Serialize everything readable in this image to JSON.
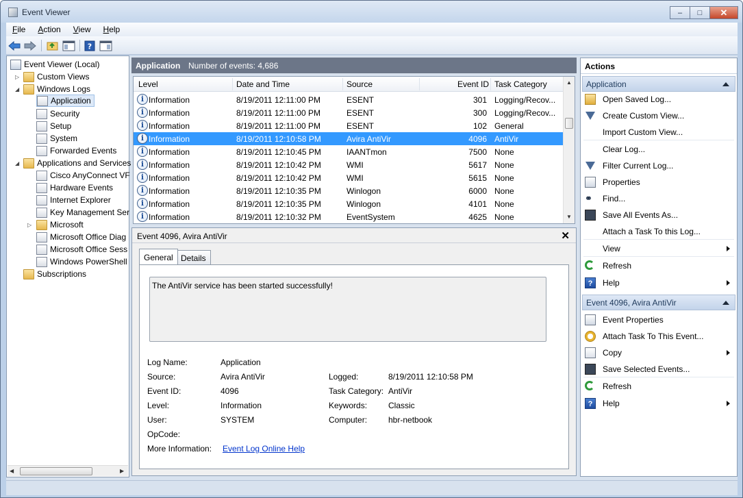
{
  "window": {
    "title": "Event Viewer",
    "min": "–",
    "max": "□",
    "close": "✕"
  },
  "menu": [
    "File",
    "Action",
    "View",
    "Help"
  ],
  "toolbar": {
    "icons": [
      "back-arrow-icon",
      "forward-arrow-icon",
      "up-folder-icon",
      "show-hide-tree-icon",
      "help-icon",
      "show-hide-action-pane-icon"
    ]
  },
  "tree": {
    "root": "Event Viewer (Local)",
    "custom_views": "Custom Views",
    "windows_logs": "Windows Logs",
    "windows_logs_items": [
      "Application",
      "Security",
      "Setup",
      "System",
      "Forwarded Events"
    ],
    "apps_services": "Applications and Services",
    "apps_services_items": [
      "Cisco AnyConnect VF",
      "Hardware Events",
      "Internet Explorer",
      "Key Management Ser",
      "Microsoft",
      "Microsoft Office Diag",
      "Microsoft Office Sess",
      "Windows PowerShell"
    ],
    "subscriptions": "Subscriptions"
  },
  "center": {
    "log_name": "Application",
    "event_count": "Number of events: 4,686",
    "columns": [
      "Level",
      "Date and Time",
      "Source",
      "Event ID",
      "Task Category"
    ],
    "rows": [
      {
        "level": "Information",
        "date": "8/19/2011 12:11:00 PM",
        "source": "ESENT",
        "id": "301",
        "category": "Logging/Recov..."
      },
      {
        "level": "Information",
        "date": "8/19/2011 12:11:00 PM",
        "source": "ESENT",
        "id": "300",
        "category": "Logging/Recov..."
      },
      {
        "level": "Information",
        "date": "8/19/2011 12:11:00 PM",
        "source": "ESENT",
        "id": "102",
        "category": "General"
      },
      {
        "level": "Information",
        "date": "8/19/2011 12:10:58 PM",
        "source": "Avira AntiVir",
        "id": "4096",
        "category": "AntiVir"
      },
      {
        "level": "Information",
        "date": "8/19/2011 12:10:45 PM",
        "source": "IAANTmon",
        "id": "7500",
        "category": "None"
      },
      {
        "level": "Information",
        "date": "8/19/2011 12:10:42 PM",
        "source": "WMI",
        "id": "5617",
        "category": "None"
      },
      {
        "level": "Information",
        "date": "8/19/2011 12:10:42 PM",
        "source": "WMI",
        "id": "5615",
        "category": "None"
      },
      {
        "level": "Information",
        "date": "8/19/2011 12:10:35 PM",
        "source": "Winlogon",
        "id": "6000",
        "category": "None"
      },
      {
        "level": "Information",
        "date": "8/19/2011 12:10:35 PM",
        "source": "Winlogon",
        "id": "4101",
        "category": "None"
      },
      {
        "level": "Information",
        "date": "8/19/2011 12:10:32 PM",
        "source": "EventSystem",
        "id": "4625",
        "category": "None"
      }
    ],
    "selected_row": 3
  },
  "detail": {
    "title": "Event 4096, Avira AntiVir",
    "close": "✕",
    "tabs": [
      "General",
      "Details"
    ],
    "description": "The AntiVir service has been started successfully!",
    "labels": {
      "log_name": "Log Name:",
      "source": "Source:",
      "event_id": "Event ID:",
      "level": "Level:",
      "user": "User:",
      "opcode": "OpCode:",
      "more_info": "More Information:",
      "logged": "Logged:",
      "task_category": "Task Category:",
      "keywords": "Keywords:",
      "computer": "Computer:"
    },
    "values": {
      "log_name": "Application",
      "source": "Avira AntiVir",
      "event_id": "4096",
      "level": "Information",
      "user": "SYSTEM",
      "opcode": "",
      "more_info": "Event Log Online Help",
      "logged": "8/19/2011 12:10:58 PM",
      "task_category": "AntiVir",
      "keywords": "Classic",
      "computer": "hbr-netbook"
    }
  },
  "actions": {
    "title": "Actions",
    "section1": "Application",
    "section1_items": [
      "Open Saved Log...",
      "Create Custom View...",
      "Import Custom View...",
      "Clear Log...",
      "Filter Current Log...",
      "Properties",
      "Find...",
      "Save All Events As...",
      "Attach a Task To this Log...",
      "View",
      "Refresh",
      "Help"
    ],
    "section2": "Event 4096, Avira AntiVir",
    "section2_items": [
      "Event Properties",
      "Attach Task To This Event...",
      "Copy",
      "Save Selected Events...",
      "Refresh",
      "Help"
    ]
  }
}
